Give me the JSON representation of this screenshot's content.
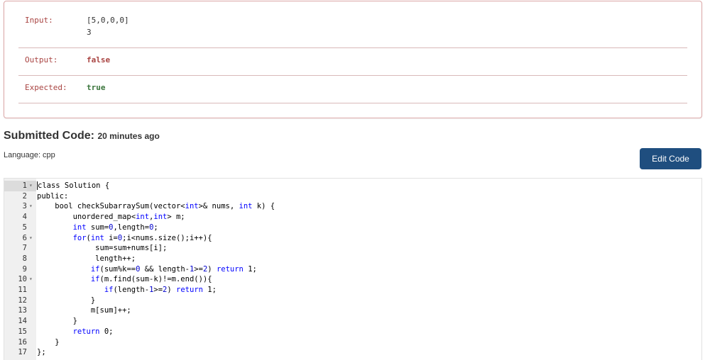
{
  "result": {
    "input_label": "Input:",
    "input_line1": "[5,0,0,0]",
    "input_line2": "3",
    "output_label": "Output:",
    "output_value": "false",
    "expected_label": "Expected:",
    "expected_value": "true"
  },
  "submission": {
    "title": "Submitted Code:",
    "time": "20 minutes ago",
    "language": "Language: cpp",
    "edit_button": "Edit Code"
  },
  "code": {
    "lines": [
      {
        "n": "1",
        "fold": true,
        "t": "class Solution {"
      },
      {
        "n": "2",
        "fold": false,
        "t": "public:"
      },
      {
        "n": "3",
        "fold": true,
        "t": "    bool checkSubarraySum(vector<int>& nums, int k) {"
      },
      {
        "n": "4",
        "fold": false,
        "t": "        unordered_map<int,int> m;"
      },
      {
        "n": "5",
        "fold": false,
        "t": "        int sum=0,length=0;"
      },
      {
        "n": "6",
        "fold": true,
        "t": "        for(int i=0;i<nums.size();i++){"
      },
      {
        "n": "7",
        "fold": false,
        "t": "             sum=sum+nums[i];"
      },
      {
        "n": "8",
        "fold": false,
        "t": "             length++;"
      },
      {
        "n": "9",
        "fold": false,
        "t": "            if(sum%k==0 && length-1>=2) return 1;"
      },
      {
        "n": "10",
        "fold": true,
        "t": "            if(m.find(sum-k)!=m.end()){"
      },
      {
        "n": "11",
        "fold": false,
        "t": "               if(length-1>=2) return 1;"
      },
      {
        "n": "12",
        "fold": false,
        "t": "            }"
      },
      {
        "n": "13",
        "fold": false,
        "t": "            m[sum]++;"
      },
      {
        "n": "14",
        "fold": false,
        "t": "        }"
      },
      {
        "n": "15",
        "fold": false,
        "t": "        return 0;"
      },
      {
        "n": "16",
        "fold": false,
        "t": "    }"
      },
      {
        "n": "17",
        "fold": false,
        "t": "};"
      }
    ]
  }
}
